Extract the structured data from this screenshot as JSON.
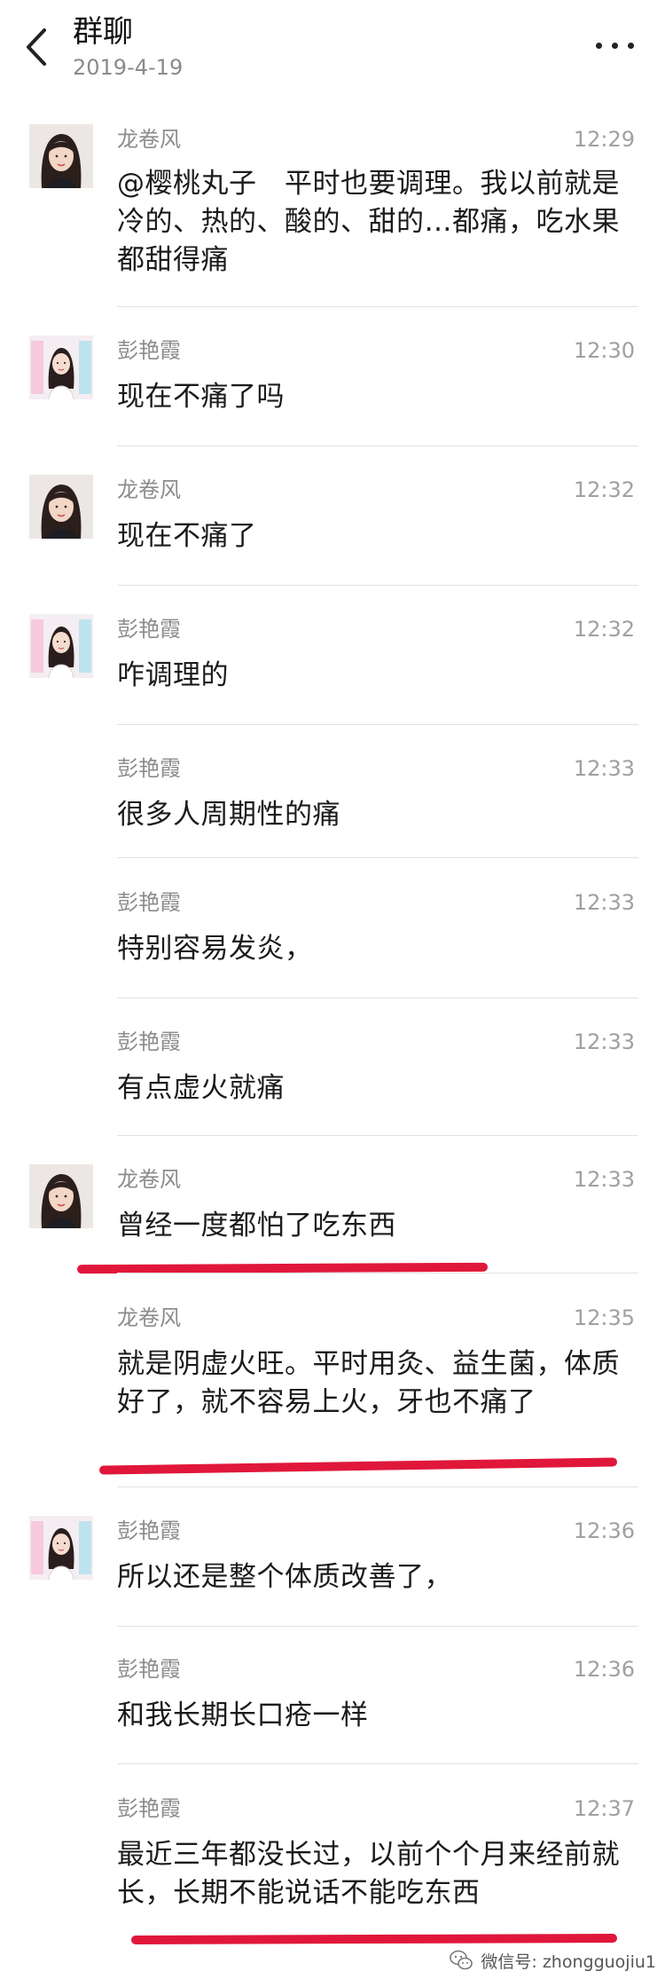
{
  "header": {
    "title": "群聊",
    "date": "2019-4-19"
  },
  "messages": [
    {
      "sender": "龙卷风",
      "time": "12:29",
      "text": "@樱桃丸子　平时也要调理。我以前就是冷的、热的、酸的、甜的…都痛，吃水果都甜得痛",
      "avatar": "longjuanfeng"
    },
    {
      "sender": "彭艳霞",
      "time": "12:30",
      "text": "现在不痛了吗",
      "avatar": "pengyanxia"
    },
    {
      "sender": "龙卷风",
      "time": "12:32",
      "text": "现在不痛了",
      "avatar": "longjuanfeng"
    },
    {
      "sender": "彭艳霞",
      "time": "12:32",
      "text": "咋调理的",
      "avatar": "pengyanxia"
    },
    {
      "sender": "彭艳霞",
      "time": "12:33",
      "text": "很多人周期性的痛",
      "avatar": ""
    },
    {
      "sender": "彭艳霞",
      "time": "12:33",
      "text": "特别容易发炎，",
      "avatar": ""
    },
    {
      "sender": "彭艳霞",
      "time": "12:33",
      "text": "有点虚火就痛",
      "avatar": ""
    },
    {
      "sender": "龙卷风",
      "time": "12:33",
      "text": "曾经一度都怕了吃东西",
      "avatar": "longjuanfeng"
    },
    {
      "sender": "龙卷风",
      "time": "12:35",
      "text": "就是阴虚火旺。平时用灸、益生菌，体质好了，就不容易上火，牙也不痛了",
      "avatar": ""
    },
    {
      "sender": "彭艳霞",
      "time": "12:36",
      "text": "所以还是整个体质改善了，",
      "avatar": "pengyanxia"
    },
    {
      "sender": "彭艳霞",
      "time": "12:36",
      "text": "和我长期长口疮一样",
      "avatar": ""
    },
    {
      "sender": "彭艳霞",
      "time": "12:37",
      "text": "最近三年都没长过，以前个个月来经前就长，长期不能说话不能吃东西",
      "avatar": ""
    }
  ],
  "highlight_color": "#e0173a",
  "watermark": {
    "text": "微信号: zhongguojiu1",
    "icon": "wechat-icon"
  }
}
